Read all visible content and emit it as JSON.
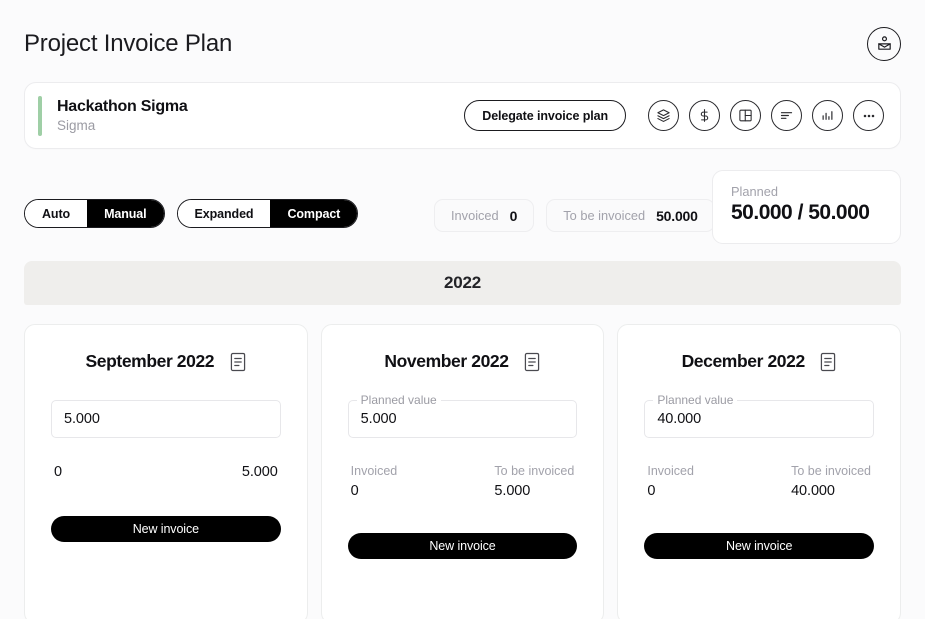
{
  "header": {
    "title": "Project Invoice Plan",
    "avatar_icon": "contact-card-icon"
  },
  "project": {
    "name": "Hackathon Sigma",
    "subtitle": "Sigma",
    "accent_color": "#9fcfa6",
    "delegate_label": "Delegate invoice plan",
    "actions": [
      {
        "name": "layers-icon",
        "title": "Layers"
      },
      {
        "name": "dollar-icon",
        "title": "Currency"
      },
      {
        "name": "layout-panel-icon",
        "title": "Layout"
      },
      {
        "name": "align-left-icon",
        "title": "Sort"
      },
      {
        "name": "bar-chart-icon",
        "title": "Statistics"
      },
      {
        "name": "ellipsis-icon",
        "title": "More"
      }
    ]
  },
  "controls": {
    "mode_toggle": {
      "options": [
        "Auto",
        "Manual"
      ],
      "active": "Manual"
    },
    "density_toggle": {
      "options": [
        "Expanded",
        "Compact"
      ],
      "active": "Compact"
    },
    "chips": [
      {
        "label": "Invoiced",
        "value": "0"
      },
      {
        "label": "To be invoiced",
        "value": "50.000"
      }
    ],
    "planned": {
      "label": "Planned",
      "value": "50.000 / 50.000"
    }
  },
  "timeline": {
    "year": "2022"
  },
  "months": [
    {
      "title": "September 2022",
      "note_icon": "document-note-icon",
      "field": {
        "legend": "",
        "value": "5.000",
        "has_legend": false
      },
      "stats": [
        {
          "label": "",
          "value": "0"
        },
        {
          "label": "",
          "value": "5.000"
        }
      ],
      "action_label": "New invoice"
    },
    {
      "title": "November 2022",
      "note_icon": "document-note-icon",
      "field": {
        "legend": "Planned value",
        "value": "5.000",
        "has_legend": true
      },
      "stats": [
        {
          "label": "Invoiced",
          "value": "0"
        },
        {
          "label": "To be invoiced",
          "value": "5.000"
        }
      ],
      "action_label": "New invoice"
    },
    {
      "title": "December 2022",
      "note_icon": "document-note-icon",
      "field": {
        "legend": "Planned value",
        "value": "40.000",
        "has_legend": true
      },
      "stats": [
        {
          "label": "Invoiced",
          "value": "0"
        },
        {
          "label": "To be invoiced",
          "value": "40.000"
        }
      ],
      "action_label": "New invoice"
    }
  ]
}
